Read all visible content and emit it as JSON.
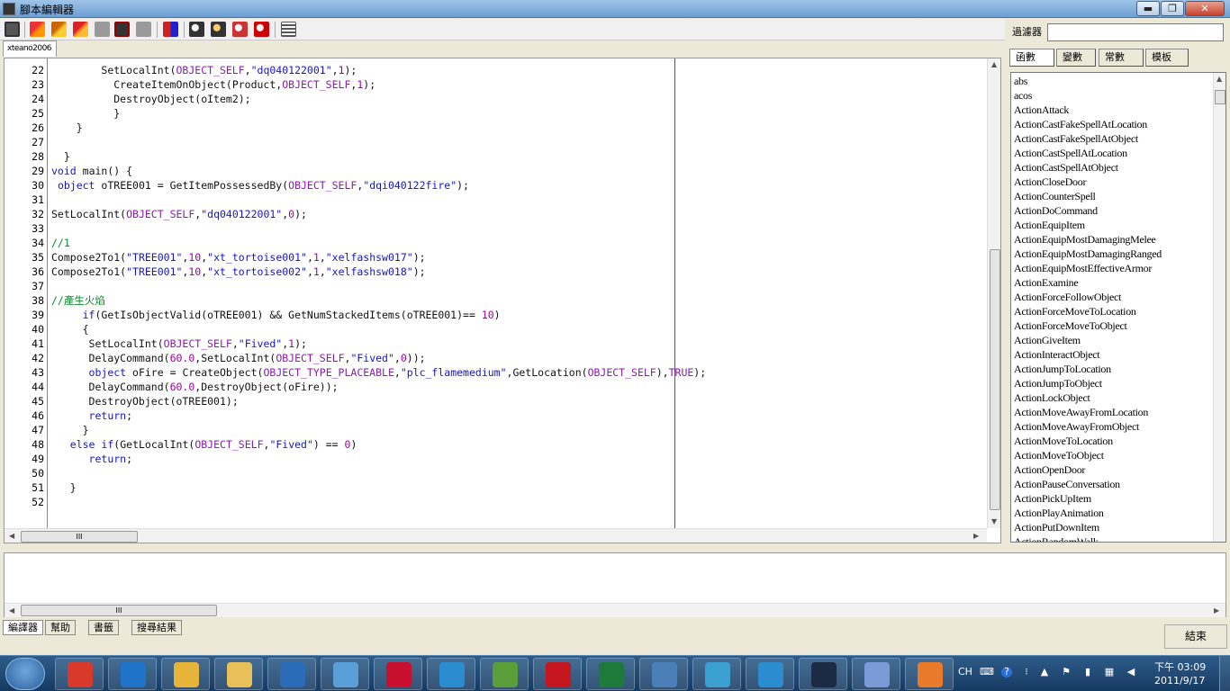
{
  "window": {
    "title": "腳本編輯器",
    "min_glyph": "▬",
    "max_glyph": "❐",
    "close_glyph": "✕"
  },
  "file_tab": "xteano2006",
  "code": {
    "lines": [
      {
        "n": "22",
        "t": "        SetLocalInt(OBJECT_SELF,\"dq040122001\",1);"
      },
      {
        "n": "23",
        "t": "          CreateItemOnObject(Product,OBJECT_SELF,1);"
      },
      {
        "n": "24",
        "t": "          DestroyObject(oItem2);"
      },
      {
        "n": "25",
        "t": "          }"
      },
      {
        "n": "26",
        "t": "    }"
      },
      {
        "n": "27",
        "t": ""
      },
      {
        "n": "28",
        "t": "  }"
      },
      {
        "n": "29",
        "t": "void main() {"
      },
      {
        "n": "30",
        "t": " object oTREE001 = GetItemPossessedBy(OBJECT_SELF,\"dqi040122fire\");"
      },
      {
        "n": "31",
        "t": ""
      },
      {
        "n": "32",
        "t": "SetLocalInt(OBJECT_SELF,\"dq040122001\",0);"
      },
      {
        "n": "33",
        "t": ""
      },
      {
        "n": "34",
        "t": "//1"
      },
      {
        "n": "35",
        "t": "Compose2To1(\"TREE001\",10,\"xt_tortoise001\",1,\"xelfashsw017\");"
      },
      {
        "n": "36",
        "t": "Compose2To1(\"TREE001\",10,\"xt_tortoise002\",1,\"xelfashsw018\");"
      },
      {
        "n": "37",
        "t": ""
      },
      {
        "n": "38",
        "t": "//產生火焰"
      },
      {
        "n": "39",
        "t": "     if(GetIsObjectValid(oTREE001) && GetNumStackedItems(oTREE001)== 10)"
      },
      {
        "n": "40",
        "t": "     {"
      },
      {
        "n": "41",
        "t": "      SetLocalInt(OBJECT_SELF,\"Fived\",1);"
      },
      {
        "n": "42",
        "t": "      DelayCommand(60.0,SetLocalInt(OBJECT_SELF,\"Fived\",0));"
      },
      {
        "n": "43",
        "t": "      object oFire = CreateObject(OBJECT_TYPE_PLACEABLE,\"plc_flamemedium\",GetLocation(OBJECT_SELF),TRUE);"
      },
      {
        "n": "44",
        "t": "      DelayCommand(60.0,DestroyObject(oFire));"
      },
      {
        "n": "45",
        "t": "      DestroyObject(oTREE001);"
      },
      {
        "n": "46",
        "t": "      return;"
      },
      {
        "n": "47",
        "t": "     }"
      },
      {
        "n": "48",
        "t": "   else if(GetLocalInt(OBJECT_SELF,\"Fived\") == 0)"
      },
      {
        "n": "49",
        "t": "      return;"
      },
      {
        "n": "50",
        "t": ""
      },
      {
        "n": "51",
        "t": "   }"
      },
      {
        "n": "52",
        "t": ""
      }
    ]
  },
  "scrollbar_grip": "III",
  "panel": {
    "filter_label": "過濾器",
    "tabs": [
      "函數",
      "變數",
      "常數",
      "模板"
    ],
    "functions": [
      "abs",
      "acos",
      "ActionAttack",
      "ActionCastFakeSpellAtLocation",
      "ActionCastFakeSpellAtObject",
      "ActionCastSpellAtLocation",
      "ActionCastSpellAtObject",
      "ActionCloseDoor",
      "ActionCounterSpell",
      "ActionDoCommand",
      "ActionEquipItem",
      "ActionEquipMostDamagingMelee",
      "ActionEquipMostDamagingRanged",
      "ActionEquipMostEffectiveArmor",
      "ActionExamine",
      "ActionForceFollowObject",
      "ActionForceMoveToLocation",
      "ActionForceMoveToObject",
      "ActionGiveItem",
      "ActionInteractObject",
      "ActionJumpToLocation",
      "ActionJumpToObject",
      "ActionLockObject",
      "ActionMoveAwayFromLocation",
      "ActionMoveAwayFromObject",
      "ActionMoveToLocation",
      "ActionMoveToObject",
      "ActionOpenDoor",
      "ActionPauseConversation",
      "ActionPickUpItem",
      "ActionPlayAnimation",
      "ActionPutDownItem",
      "ActionRandomWalk"
    ]
  },
  "bottom_tabs": [
    "編譯器",
    "幫助",
    "書籤",
    "搜尋結果"
  ],
  "finish_button": "結束",
  "taskbar": {
    "apps": [
      "chrome",
      "internet-explorer",
      "notes",
      "file-explorer",
      "quick-launch",
      "picasa",
      "acrobat",
      "itunes",
      "evernote",
      "solidworks",
      "excel",
      "remote-desktop",
      "messenger",
      "itunes-2",
      "script-editor",
      "paint",
      "media-player"
    ],
    "tray": {
      "lang": "CH",
      "time": "下午 03:09",
      "date": "2011/9/17"
    }
  },
  "colors": {
    "keyword": "#1515c8",
    "constant": "#8a1ab0",
    "string": "#1515c8",
    "number": "#a000a0",
    "comment": "#0a8a2a"
  }
}
